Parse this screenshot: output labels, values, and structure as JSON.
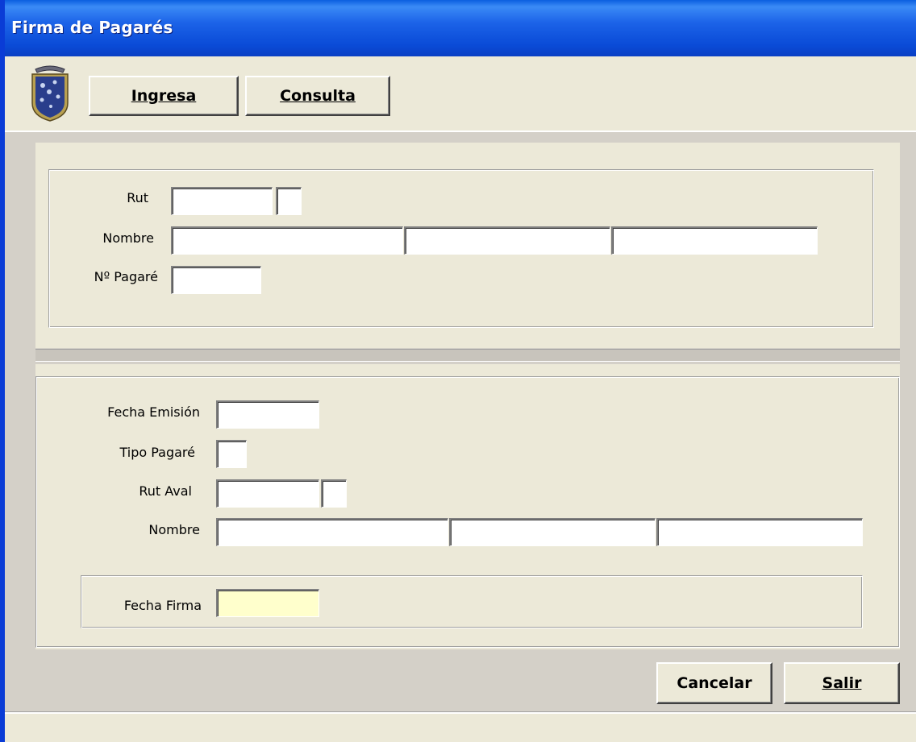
{
  "window": {
    "title": "Firma de Pagarés"
  },
  "toolbar": {
    "ingresa_label": "Ingresa",
    "consulta_label": "Consulta"
  },
  "search_section": {
    "rut_label": "Rut",
    "nombre_label": "Nombre",
    "pagare_label": "Nº Pagaré",
    "rut_value": "",
    "rut_dv_value": "",
    "nombre_1_value": "",
    "nombre_2_value": "",
    "nombre_3_value": "",
    "pagare_value": ""
  },
  "detail_section": {
    "fecha_emision_label": "Fecha Emisión",
    "tipo_pagare_label": "Tipo Pagaré",
    "rut_aval_label": "Rut Aval",
    "nombre_label": "Nombre",
    "fecha_firma_label": "Fecha Firma",
    "fecha_emision_value": "",
    "tipo_pagare_value": "",
    "rut_aval_value": "",
    "rut_aval_dv_value": "",
    "nombre_1_value": "",
    "nombre_2_value": "",
    "nombre_3_value": "",
    "fecha_firma_value": ""
  },
  "footer": {
    "cancelar_label": "Cancelar",
    "salir_label": "Salir"
  },
  "colors": {
    "titlebar": "#0A4BD7",
    "window_bg": "#ECE9D8",
    "fecha_firma_bg": "#FFFFCC"
  }
}
